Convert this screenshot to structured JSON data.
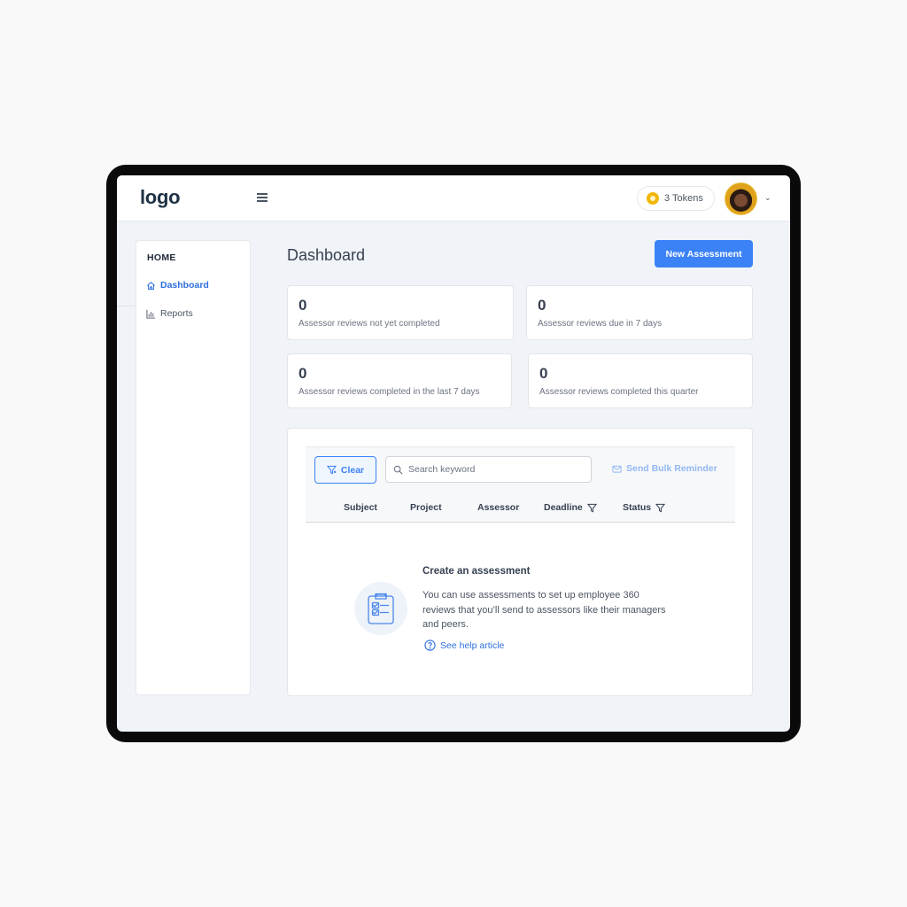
{
  "header": {
    "logo": "logo",
    "tokens_label": "3 Tokens"
  },
  "sidebar": {
    "heading": "HOME",
    "items": [
      {
        "label": "Dashboard",
        "icon": "home-icon",
        "active": true
      },
      {
        "label": "Reports",
        "icon": "bar-chart-icon",
        "active": false
      }
    ]
  },
  "main": {
    "title": "Dashboard",
    "new_button": "New Assessment",
    "stats": [
      {
        "value": "0",
        "label": "Assessor reviews not yet completed"
      },
      {
        "value": "0",
        "label": "Assessor reviews due in 7 days"
      },
      {
        "value": "0",
        "label": "Assessor reviews completed in the last 7 days"
      },
      {
        "value": "0",
        "label": "Assessor reviews completed this quarter"
      }
    ]
  },
  "table": {
    "clear_label": "Clear",
    "search_placeholder": "Search keyword",
    "bulk_label": "Send Bulk Reminder",
    "columns": [
      "Subject",
      "Project",
      "Assessor",
      "Deadline",
      "Status"
    ]
  },
  "empty_state": {
    "title": "Create an assessment",
    "body": "You can use assessments to set up employee 360 reviews that you’ll send to assessors like their managers and peers.",
    "link": "See help article"
  },
  "colors": {
    "accent": "#3b82f6",
    "token_coin": "#f2b705",
    "background": "#f0f3f7"
  }
}
